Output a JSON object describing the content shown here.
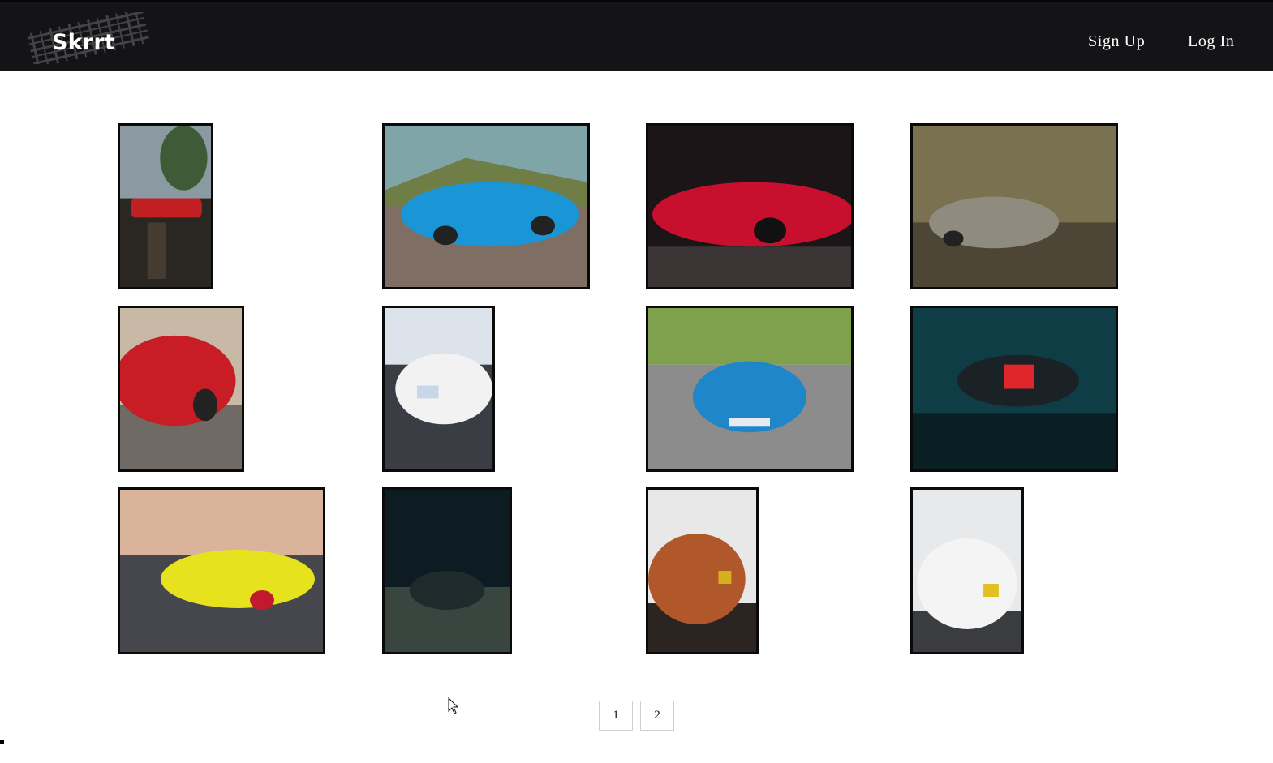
{
  "header": {
    "logo_text": "Skrrt",
    "nav": {
      "signup_label": "Sign Up",
      "login_label": "Log In"
    }
  },
  "gallery": {
    "photos": [
      {
        "subject": "red roadster on wet road",
        "colors": [
          "#8a9aa0",
          "#c21f22",
          "#2a2622"
        ]
      },
      {
        "subject": "blue sports car on mountain road",
        "colors": [
          "#7fa5a8",
          "#1a95d6",
          "#7e6e63"
        ]
      },
      {
        "subject": "red mid-engine sports car in studio",
        "colors": [
          "#1b1517",
          "#c8102e",
          "#3a3435"
        ]
      },
      {
        "subject": "silver coupe on leafy forest road",
        "colors": [
          "#7a7150",
          "#8f8b7e",
          "#4d4636"
        ]
      },
      {
        "subject": "red hatchback under bare trees",
        "colors": [
          "#c7b9a5",
          "#c81d25",
          "#6f6a64"
        ]
      },
      {
        "subject": "white sports car rear view in parking lot",
        "colors": [
          "#dde3ea",
          "#f2f2f2",
          "#3a3d44"
        ]
      },
      {
        "subject": "blue coupe front in parking lot",
        "colors": [
          "#7fa04c",
          "#1f86c9",
          "#8c8c8c"
        ]
      },
      {
        "subject": "car with red tail lights in teal fog",
        "colors": [
          "#0f3d45",
          "#e0262a",
          "#0a1f24"
        ]
      },
      {
        "subject": "yellow coupe at sunset",
        "colors": [
          "#d9b49a",
          "#e7e21e",
          "#45474d"
        ]
      },
      {
        "subject": "dark coupe at night",
        "colors": [
          "#0d1b22",
          "#1f2a2d",
          "#39463f"
        ]
      },
      {
        "subject": "bronze sports car rear view",
        "colors": [
          "#e8e8e8",
          "#b0582a",
          "#2c2421"
        ]
      },
      {
        "subject": "white sports car rear with wing",
        "colors": [
          "#e7e9ea",
          "#f4f4f4",
          "#3b3c3f"
        ]
      }
    ]
  },
  "pagination": {
    "pages": [
      "1",
      "2"
    ]
  }
}
